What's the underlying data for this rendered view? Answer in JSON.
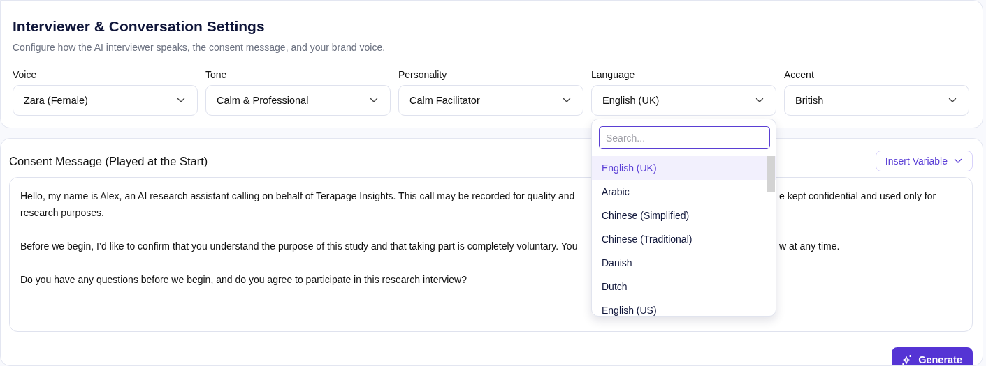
{
  "settings": {
    "title": "Interviewer & Conversation Settings",
    "subtitle": "Configure how the AI interviewer speaks, the consent message, and your brand voice.",
    "fields": [
      {
        "label": "Voice",
        "value": "Zara (Female)"
      },
      {
        "label": "Tone",
        "value": "Calm & Professional"
      },
      {
        "label": "Personality",
        "value": "Calm Facilitator"
      },
      {
        "label": "Language",
        "value": "English (UK)",
        "menu": {
          "placeholder": "Search...",
          "options": [
            {
              "label": "English (UK)",
              "selected": true
            },
            {
              "label": "Arabic",
              "selected": false
            },
            {
              "label": "Chinese (Simplified)",
              "selected": false
            },
            {
              "label": "Chinese (Traditional)",
              "selected": false
            },
            {
              "label": "Danish",
              "selected": false
            },
            {
              "label": "Dutch",
              "selected": false
            },
            {
              "label": "English (US)",
              "selected": false
            }
          ]
        }
      },
      {
        "label": "Accent",
        "value": "British"
      }
    ]
  },
  "consent": {
    "title": "Consent Message (Played at the Start)",
    "insert_button": "Insert Variable",
    "paragraphs": [
      [
        [
          "Hello, my name is Alex, an AI research assistant calling on behalf of Terapage Insights. This call may be recorded for quality and",
          "e kept confidential and used only for"
        ],
        [
          "research purposes."
        ]
      ],
      [
        [
          "Before we begin, I’d like to confirm that you understand the purpose of this study and that taking part is completely voluntary. You",
          "w at any time."
        ]
      ],
      [
        [
          "Do you have any questions before we begin, and do you agree to participate in this research interview?"
        ]
      ]
    ],
    "generate_button": "Generate"
  }
}
